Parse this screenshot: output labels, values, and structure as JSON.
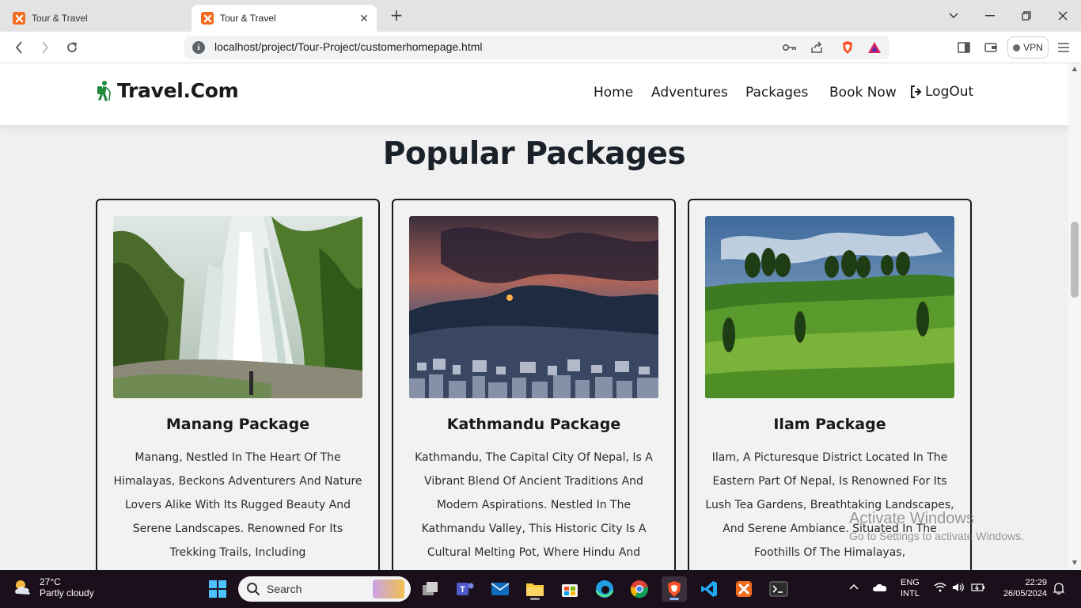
{
  "browser": {
    "tabs": [
      {
        "title": "Tour & Travel",
        "active": false
      },
      {
        "title": "Tour & Travel",
        "active": true
      }
    ],
    "url": "localhost/project/Tour-Project/customerhomepage.html",
    "vpn_label": "VPN",
    "accent_color": "#f26b1d"
  },
  "site": {
    "logo_text": "Travel.Com",
    "nav": [
      "Home",
      "Adventures",
      "Packages",
      "Book Now",
      "LogOut"
    ]
  },
  "section": {
    "title": "Popular Packages"
  },
  "packages": [
    {
      "name": "Manang Package",
      "image": "waterfall-photo",
      "description": "Manang, Nestled In The Heart Of The Himalayas, Beckons Adventurers And Nature Lovers Alike With Its Rugged Beauty And Serene Landscapes. Renowned For Its Trekking Trails, Including"
    },
    {
      "name": "Kathmandu Package",
      "image": "city-night-photo",
      "description": "Kathmandu, The Capital City Of Nepal, Is A Vibrant Blend Of Ancient Traditions And Modern Aspirations. Nestled In The Kathmandu Valley, This Historic City Is A Cultural Melting Pot, Where Hindu And"
    },
    {
      "name": "Ilam Package",
      "image": "tea-garden-photo",
      "description": "Ilam, A Picturesque District Located In The Eastern Part Of Nepal, Is Renowned For Its Lush Tea Gardens, Breathtaking Landscapes, And Serene Ambiance. Situated In The Foothills Of The Himalayas,"
    }
  ],
  "watermark": {
    "line1": "Activate Windows",
    "line2": "Go to Settings to activate Windows."
  },
  "taskbar": {
    "temperature": "27°C",
    "weather": "Partly cloudy",
    "search_label": "Search",
    "language_top": "ENG",
    "language_bottom": "INTL",
    "time": "22:29",
    "date": "26/05/2024"
  }
}
